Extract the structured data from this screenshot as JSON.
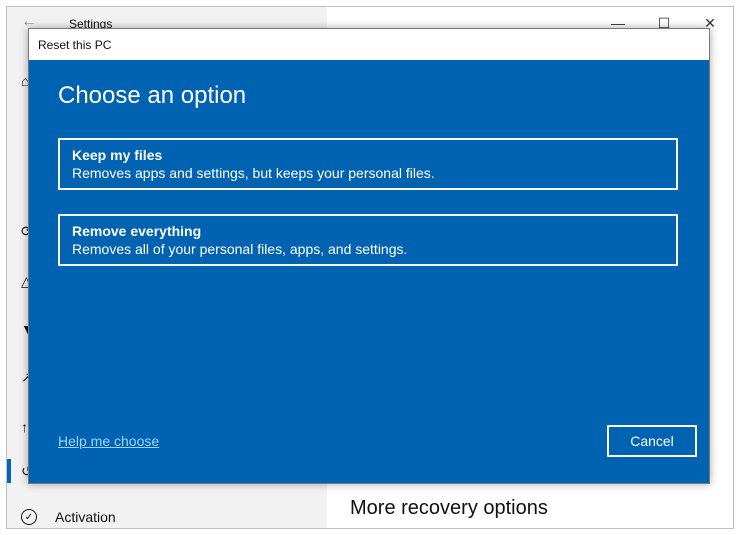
{
  "settings": {
    "title": "Settings",
    "more_recovery_heading": "More recovery options",
    "activation_label": "Activation"
  },
  "dialog": {
    "title": "Reset this PC",
    "heading": "Choose an option",
    "options": [
      {
        "title": "Keep my files",
        "description": "Removes apps and settings, but keeps your personal files."
      },
      {
        "title": "Remove everything",
        "description": "Removes all of your personal files, apps, and settings."
      }
    ],
    "help_link": "Help me choose",
    "cancel_label": "Cancel"
  },
  "colors": {
    "dialog_background": "#0063b1",
    "link": "#9fd1ff",
    "accent": "#0067c0"
  },
  "icons": [
    "back-arrow-icon",
    "minimize-icon",
    "maximize-icon",
    "close-icon",
    "home-icon",
    "update-icon",
    "delivery-icon",
    "shield-icon",
    "troubleshoot-icon",
    "recovery-icon",
    "activation-icon"
  ]
}
